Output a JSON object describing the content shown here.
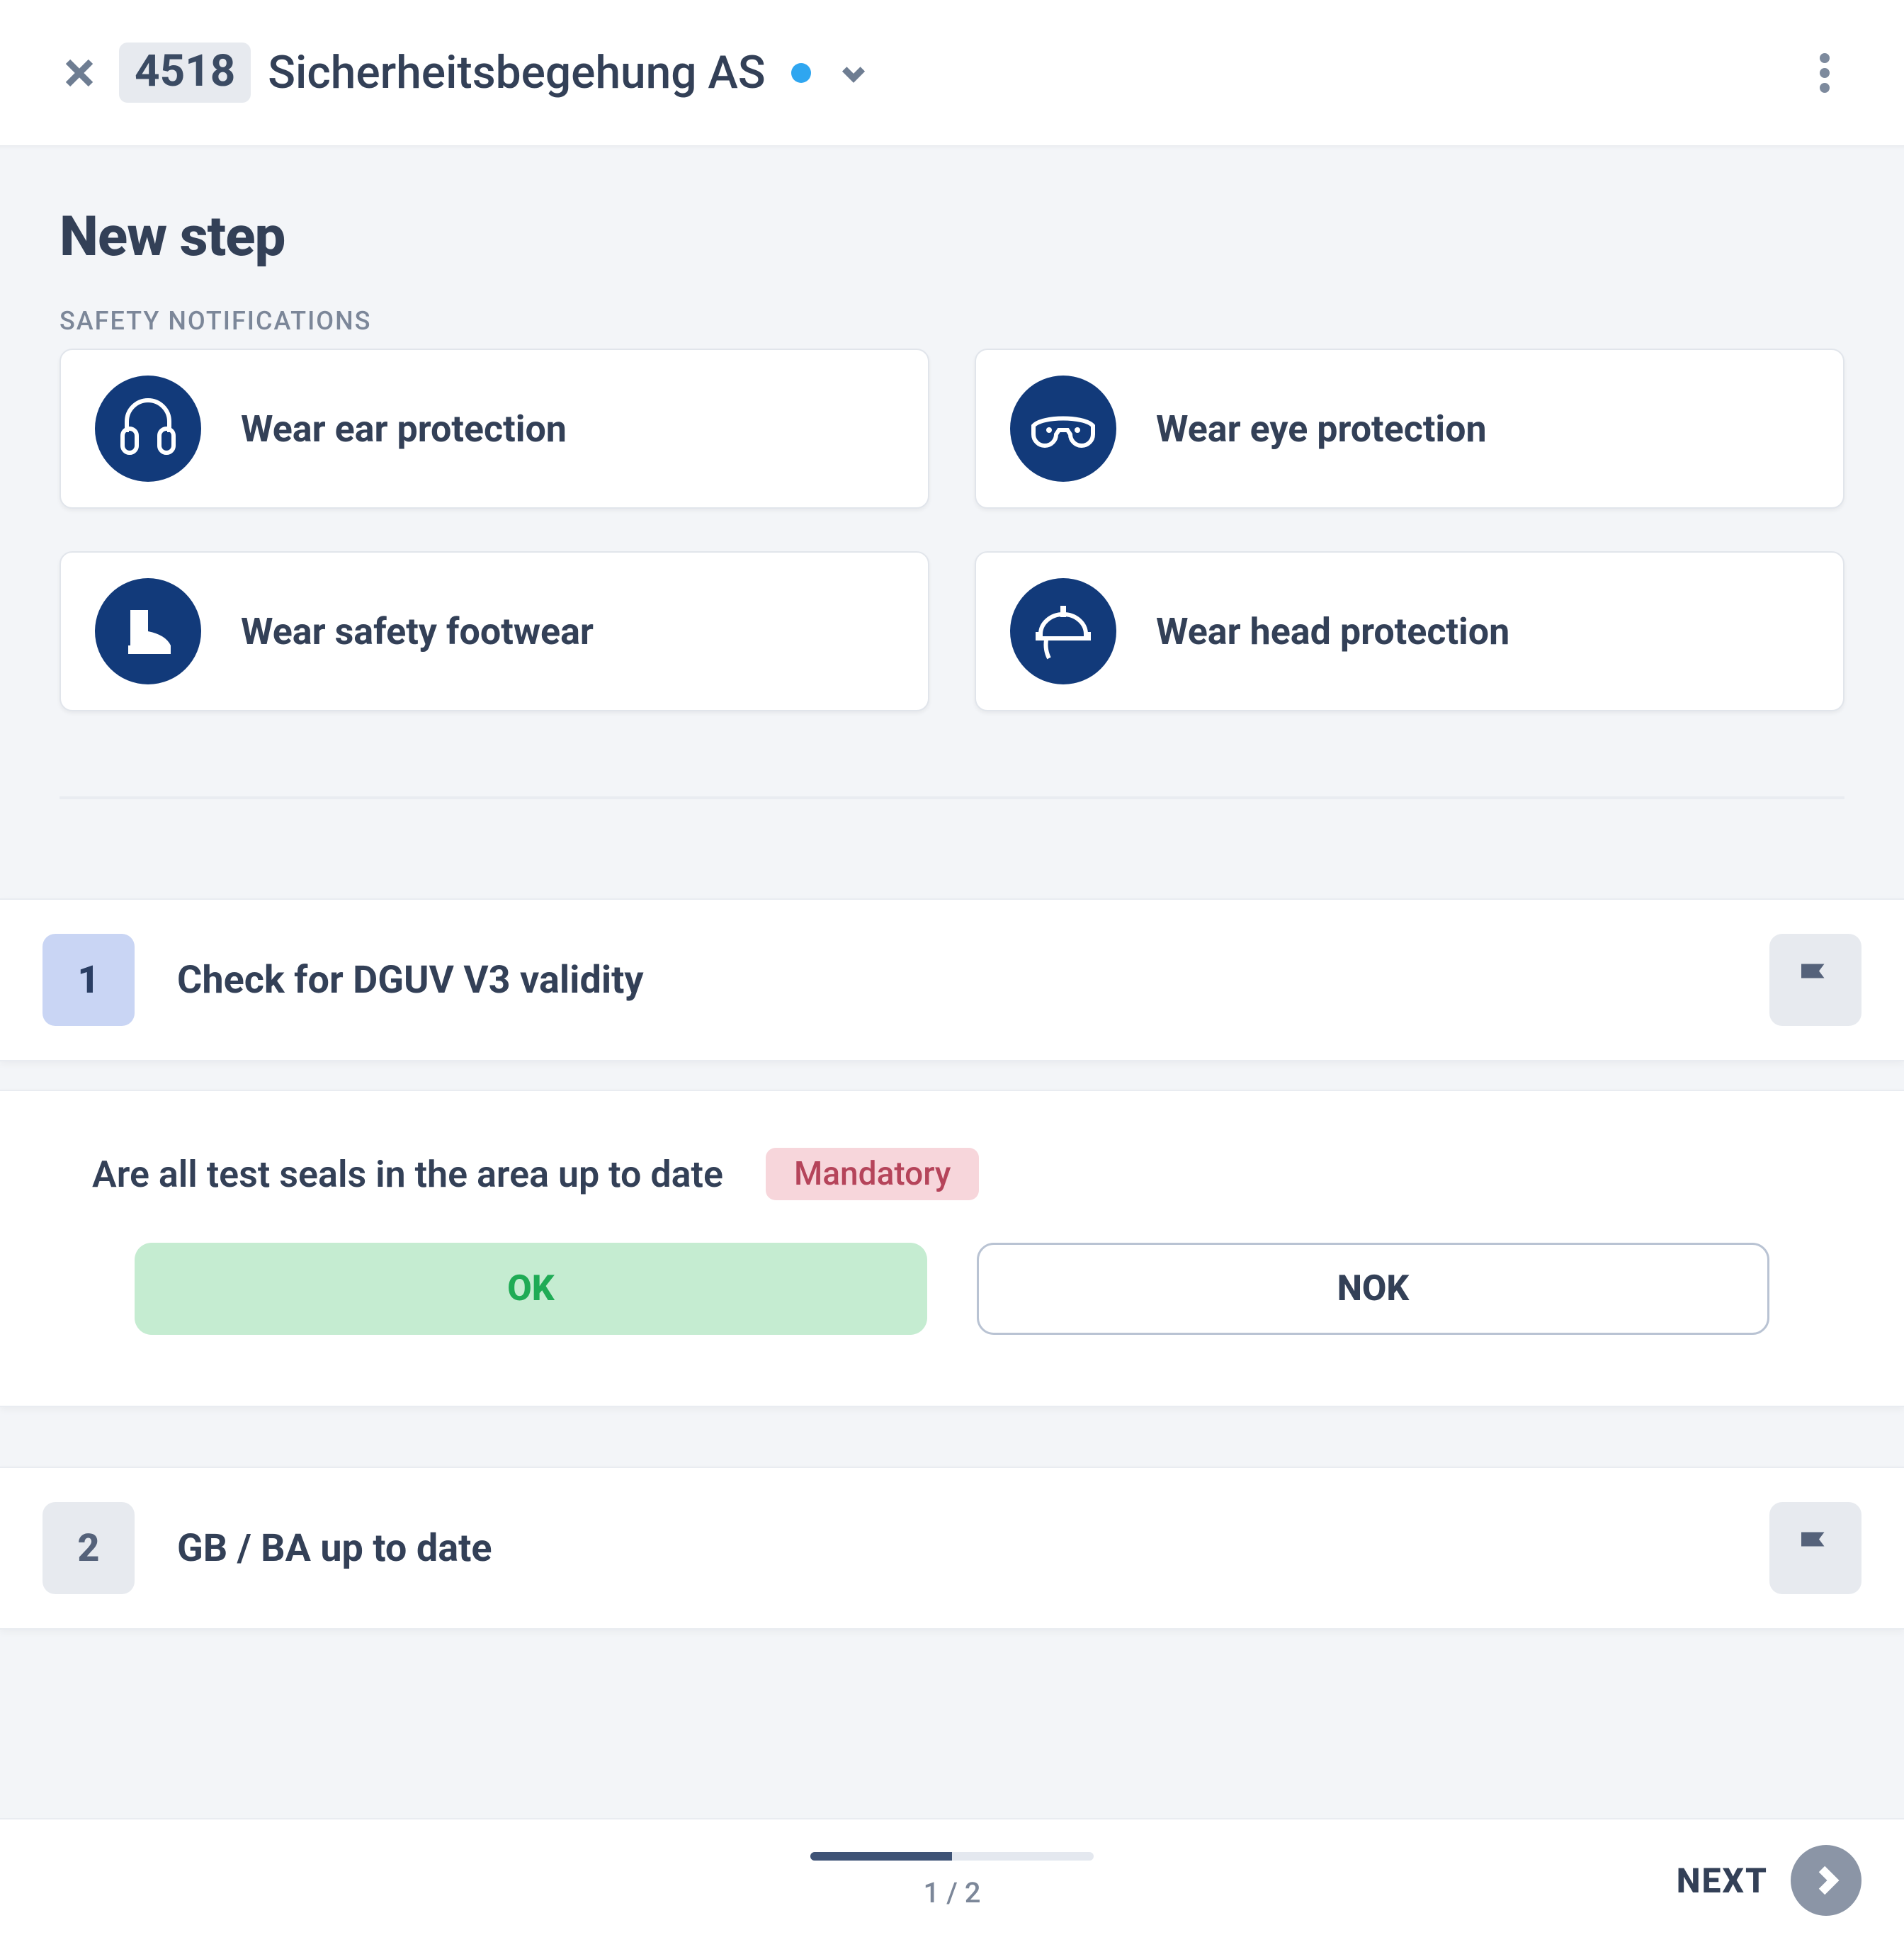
{
  "header": {
    "record_id": "4518",
    "title": "Sicherheitsbegehung AS",
    "status_color": "#2fa6f0"
  },
  "new_step": {
    "heading": "New step",
    "safety_label": "SAFETY NOTIFICATIONS",
    "safety_items": [
      {
        "icon": "ear-protection-icon",
        "label": "Wear ear protection"
      },
      {
        "icon": "eye-protection-icon",
        "label": "Wear eye protection"
      },
      {
        "icon": "safety-footwear-icon",
        "label": "Wear safety footwear"
      },
      {
        "icon": "head-protection-icon",
        "label": "Wear head protection"
      }
    ]
  },
  "steps": [
    {
      "number": "1",
      "title": "Check for DGUV V3 validity",
      "active": true
    },
    {
      "number": "2",
      "title": "GB / BA up to date",
      "active": false
    }
  ],
  "question": {
    "text": "Are all test seals in the area up to date",
    "badge": "Mandatory",
    "answers": {
      "ok": "OK",
      "nok": "NOK"
    },
    "selected": "ok"
  },
  "footer": {
    "progress_text": "1 / 2",
    "progress_fraction": 0.5,
    "next_label": "NEXT"
  }
}
